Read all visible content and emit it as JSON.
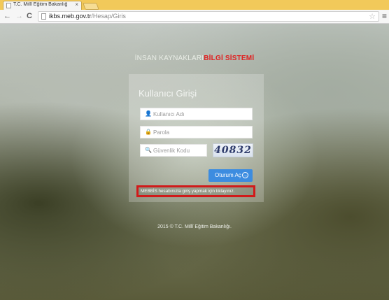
{
  "browser": {
    "tab_title": "T.C. Millî Eğitim Bakanlığ",
    "tab_close": "×",
    "url_host": "ikbs.meb.gov.tr",
    "url_path": "/Hesap/Giris",
    "back": "←",
    "forward": "→",
    "reload": "C",
    "star": "☆",
    "menu": "≡"
  },
  "page": {
    "brand_part1": "İNSAN KAYNAKLARI",
    "brand_part2": "BİLGİ SİSTEMİ",
    "login_title": "Kullanıcı Girişi",
    "username_placeholder": "Kullanıcı Adı",
    "password_placeholder": "Parola",
    "captcha_placeholder": "Güvenlik Kodu",
    "captcha_code": "40832",
    "login_button": "Oturum Aç",
    "login_button_arrow": "→",
    "mebbis_link": "MEBBİS hesabınızla giriş yapmak için tıklayınız.",
    "footer": "2015 © T.C. Millî Eğitim Bakanlığı."
  },
  "colors": {
    "tabbar": "#f2c95a",
    "brand_red": "#e02020",
    "button_blue": "#3c8ce0",
    "highlight_red": "#d11a1a"
  }
}
